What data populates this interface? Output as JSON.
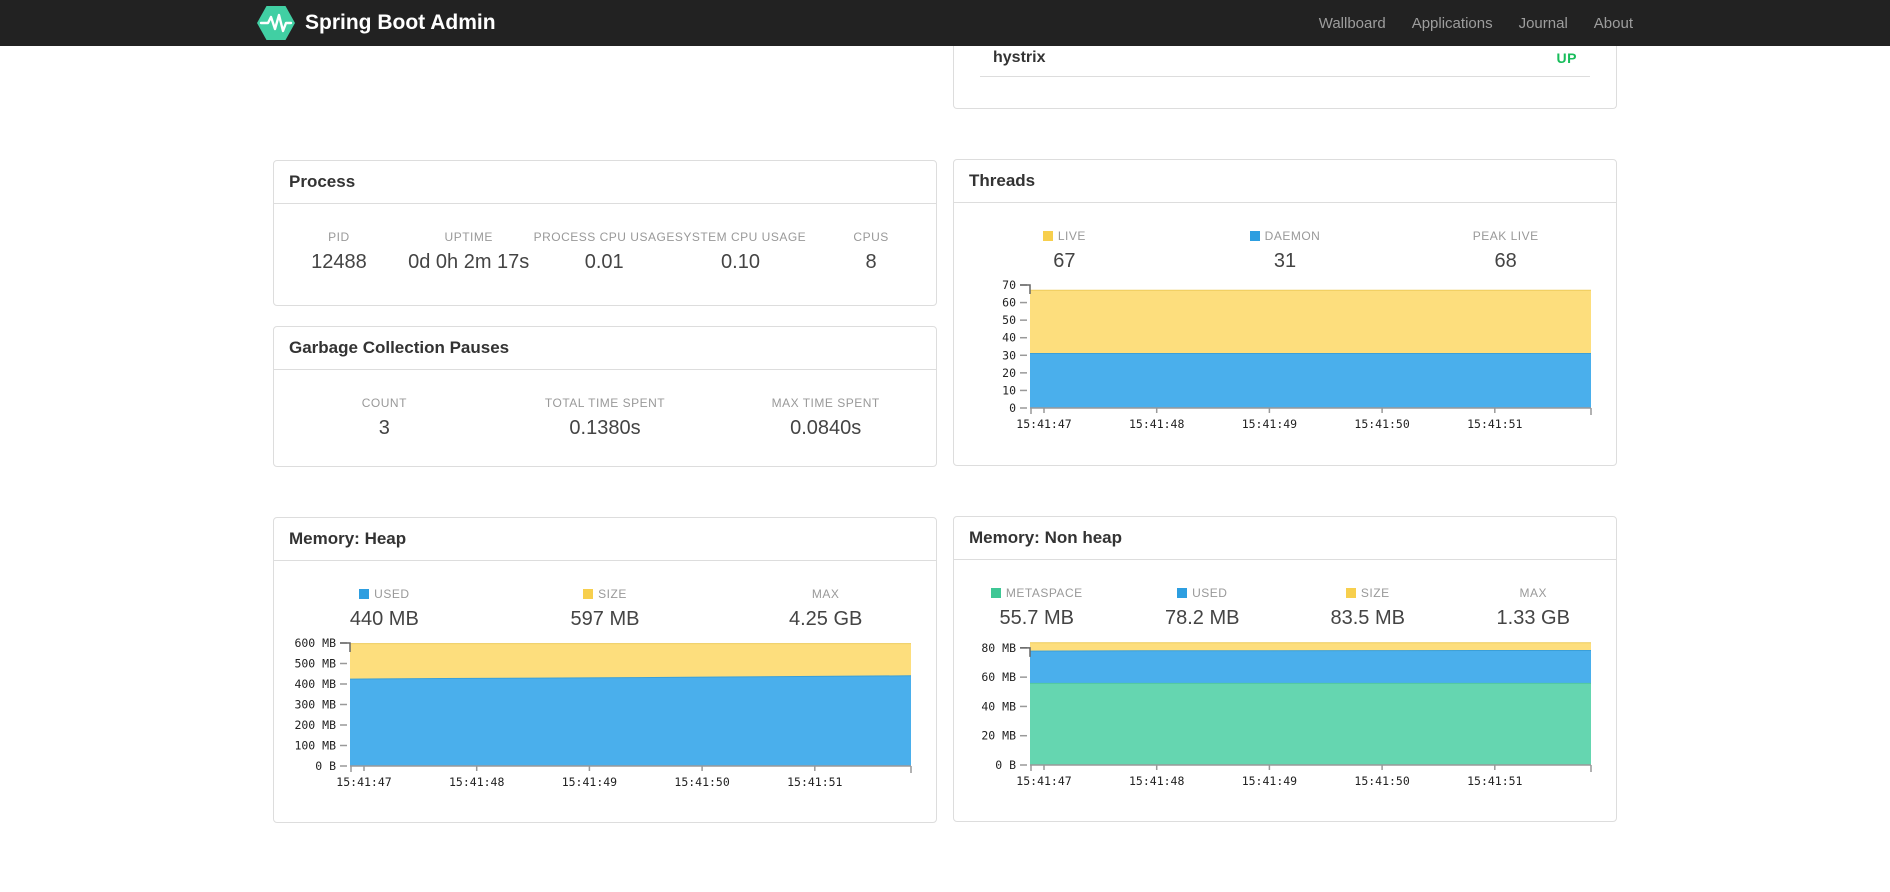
{
  "navbar": {
    "brand": "Spring Boot Admin",
    "links": [
      {
        "label": "Wallboard"
      },
      {
        "label": "Applications"
      },
      {
        "label": "Journal"
      },
      {
        "label": "About"
      }
    ]
  },
  "colors": {
    "brand_green": "#41CFA3",
    "status_up": "#18BD5B",
    "legend_yellow": "#F7CF4D",
    "legend_blue": "#2D9EE0",
    "legend_green": "#3EC795"
  },
  "application": {
    "name": "hystrix",
    "status": "UP"
  },
  "process": {
    "title": "Process",
    "stats": [
      {
        "label": "PID",
        "value": "12488"
      },
      {
        "label": "UPTIME",
        "value": "0d 0h 2m 17s"
      },
      {
        "label": "PROCESS CPU USAGE",
        "value": "0.01"
      },
      {
        "label": "SYSTEM CPU USAGE",
        "value": "0.10"
      },
      {
        "label": "CPUS",
        "value": "8"
      }
    ]
  },
  "gc": {
    "title": "Garbage Collection Pauses",
    "stats": [
      {
        "label": "COUNT",
        "value": "3"
      },
      {
        "label": "TOTAL TIME SPENT",
        "value": "0.1380s"
      },
      {
        "label": "MAX TIME SPENT",
        "value": "0.0840s"
      }
    ]
  },
  "threads": {
    "title": "Threads",
    "stats": [
      {
        "label": "LIVE",
        "value": "67",
        "swatch": "#F7CF4D"
      },
      {
        "label": "DAEMON",
        "value": "31",
        "swatch": "#2D9EE0"
      },
      {
        "label": "PEAK LIVE",
        "value": "68"
      }
    ]
  },
  "memory_heap": {
    "title": "Memory: Heap",
    "stats": [
      {
        "label": "USED",
        "value": "440 MB",
        "swatch": "#2D9EE0"
      },
      {
        "label": "SIZE",
        "value": "597 MB",
        "swatch": "#F7CF4D"
      },
      {
        "label": "MAX",
        "value": "4.25 GB"
      }
    ]
  },
  "memory_nonheap": {
    "title": "Memory: Non heap",
    "stats": [
      {
        "label": "METASPACE",
        "value": "55.7 MB",
        "swatch": "#3EC795"
      },
      {
        "label": "USED",
        "value": "78.2 MB",
        "swatch": "#2D9EE0"
      },
      {
        "label": "SIZE",
        "value": "83.5 MB",
        "swatch": "#F7CF4D"
      },
      {
        "label": "MAX",
        "value": "1.33 GB"
      }
    ]
  },
  "chart_data": [
    {
      "type": "area",
      "title": "Threads",
      "x": [
        "15:41:47",
        "15:41:48",
        "15:41:49",
        "15:41:50",
        "15:41:51"
      ],
      "ylim": [
        0,
        70
      ],
      "y_ticks": [
        {
          "v": 0,
          "label": "0"
        },
        {
          "v": 10,
          "label": "10"
        },
        {
          "v": 20,
          "label": "20"
        },
        {
          "v": 30,
          "label": "30"
        },
        {
          "v": 40,
          "label": "40"
        },
        {
          "v": 50,
          "label": "50"
        },
        {
          "v": 60,
          "label": "60"
        },
        {
          "v": 70,
          "label": "70"
        }
      ],
      "grid": false,
      "legend_position": "top",
      "series": [
        {
          "name": "LIVE",
          "fill": "#FDDE7D",
          "stroke": "#EECB5B",
          "values": [
            67,
            67,
            67,
            67,
            67,
            67
          ]
        },
        {
          "name": "DAEMON",
          "fill": "#4AAFEC",
          "stroke": "#3A9FD9",
          "values": [
            31,
            31,
            31,
            31,
            31,
            31
          ]
        }
      ]
    },
    {
      "type": "area",
      "title": "Memory: Heap",
      "x": [
        "15:41:47",
        "15:41:48",
        "15:41:49",
        "15:41:50",
        "15:41:51"
      ],
      "ylim": [
        0,
        600
      ],
      "y_ticks": [
        {
          "v": 0,
          "label": "0 B"
        },
        {
          "v": 100,
          "label": "100 MB"
        },
        {
          "v": 200,
          "label": "200 MB"
        },
        {
          "v": 300,
          "label": "300 MB"
        },
        {
          "v": 400,
          "label": "400 MB"
        },
        {
          "v": 500,
          "label": "500 MB"
        },
        {
          "v": 600,
          "label": "600 MB"
        }
      ],
      "grid": false,
      "legend_position": "top",
      "series": [
        {
          "name": "SIZE",
          "fill": "#FDDE7D",
          "stroke": "#EECB5B",
          "values": [
            597,
            597,
            597,
            597,
            597,
            597,
            597
          ]
        },
        {
          "name": "USED",
          "fill": "#4AAFEC",
          "stroke": "#3A9FD9",
          "values": [
            424,
            427,
            429,
            431,
            434,
            437,
            440
          ]
        }
      ]
    },
    {
      "type": "area",
      "title": "Memory: Non heap",
      "x": [
        "15:41:47",
        "15:41:48",
        "15:41:49",
        "15:41:50",
        "15:41:51"
      ],
      "ylim": [
        0,
        84
      ],
      "y_ticks": [
        {
          "v": 0,
          "label": "0 B"
        },
        {
          "v": 20,
          "label": "20 MB"
        },
        {
          "v": 40,
          "label": "40 MB"
        },
        {
          "v": 60,
          "label": "60 MB"
        },
        {
          "v": 80,
          "label": "80 MB"
        }
      ],
      "grid": false,
      "legend_position": "top",
      "series": [
        {
          "name": "SIZE",
          "fill": "#FDDE7D",
          "stroke": "#EECB5B",
          "values": [
            83.5,
            83.5,
            83.5,
            83.5,
            83.5,
            83.5
          ]
        },
        {
          "name": "USED",
          "fill": "#4AAFEC",
          "stroke": "#3A9FD9",
          "values": [
            77.8,
            78.0,
            78.0,
            78.1,
            78.2,
            78.2
          ]
        },
        {
          "name": "METASPACE",
          "fill": "#65D6B0",
          "stroke": "#52C7A0",
          "values": [
            55.7,
            55.7,
            55.7,
            55.7,
            55.7,
            55.7
          ]
        }
      ]
    }
  ]
}
